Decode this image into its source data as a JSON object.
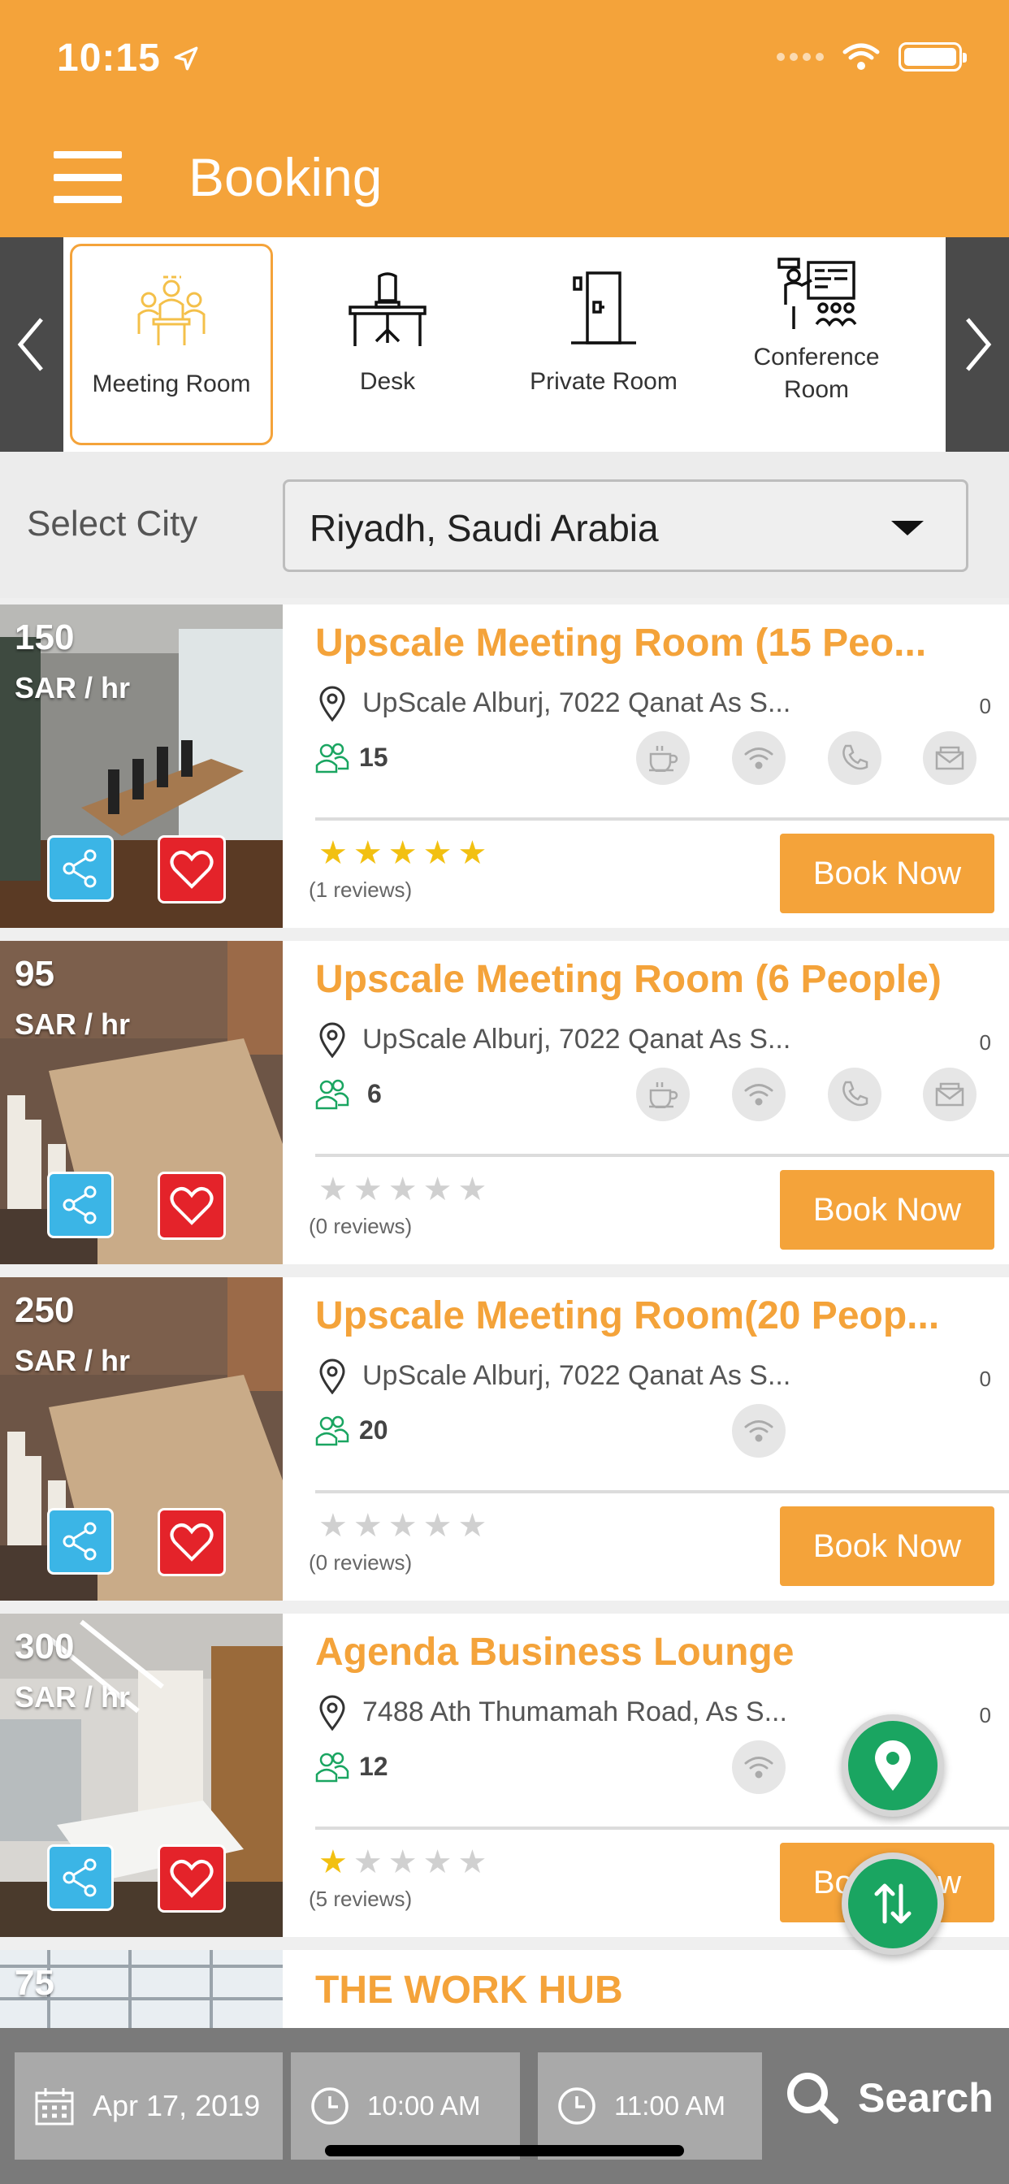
{
  "status": {
    "time": "10:15"
  },
  "header": {
    "title": "Booking"
  },
  "categories": [
    {
      "label": "Meeting Room",
      "active": true
    },
    {
      "label": "Desk",
      "active": false
    },
    {
      "label": "Private Room",
      "active": false
    },
    {
      "label": "Conference Room",
      "active": false
    }
  ],
  "city": {
    "label": "Select City",
    "value": "Riyadh, Saudi Arabia"
  },
  "listings": [
    {
      "price": "150",
      "unit": "SAR / hr",
      "title": "Upscale Meeting Room (15 Peo...",
      "address": "UpScale Alburj, 7022 Qanat As S...",
      "distance": "0",
      "capacity": "15",
      "stars": 5,
      "reviews": "(1 reviews)",
      "book": "Book Now",
      "amenities": [
        "coffee-icon",
        "wifi-icon",
        "phone-icon",
        "mail-icon"
      ]
    },
    {
      "price": "95",
      "unit": "SAR / hr",
      "title": "Upscale Meeting Room (6 People)",
      "address": "UpScale Alburj, 7022 Qanat As S...",
      "distance": "0",
      "capacity": "6",
      "stars": 0,
      "reviews": "(0 reviews)",
      "book": "Book Now",
      "amenities": [
        "coffee-icon",
        "wifi-icon",
        "phone-icon",
        "mail-icon"
      ]
    },
    {
      "price": "250",
      "unit": "SAR / hr",
      "title": "Upscale Meeting Room(20 Peop...",
      "address": "UpScale Alburj, 7022 Qanat As S...",
      "distance": "0",
      "capacity": "20",
      "stars": 0,
      "reviews": "(0 reviews)",
      "book": "Book Now",
      "amenities": [
        "wifi-icon"
      ]
    },
    {
      "price": "300",
      "unit": "SAR / hr",
      "title": "Agenda Business Lounge",
      "address": "7488 Ath Thumamah Road, As S...",
      "distance": "0",
      "capacity": "12",
      "stars": 1,
      "reviews": "(5 reviews)",
      "book": "Book Now",
      "amenities": [
        "wifi-icon"
      ]
    },
    {
      "price": "75",
      "title": "THE WORK HUB"
    }
  ],
  "bottom": {
    "date": "Apr 17, 2019",
    "start_time": "10:00 AM",
    "end_time": "11:00 AM",
    "search": "Search"
  },
  "colors": {
    "accent": "#f4a33a",
    "green": "#1aa561",
    "share": "#3bb5e6",
    "favorite": "#e4232a"
  }
}
